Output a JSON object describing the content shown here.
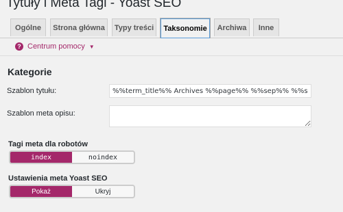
{
  "page": {
    "title": "Tytuły i Meta Tagi - Yoast SEO"
  },
  "tabs": [
    {
      "label": "Ogólne",
      "active": false
    },
    {
      "label": "Strona główna",
      "active": false
    },
    {
      "label": "Typy treści",
      "active": false
    },
    {
      "label": "Taksonomie",
      "active": true
    },
    {
      "label": "Archiwa",
      "active": false
    },
    {
      "label": "Inne",
      "active": false
    }
  ],
  "help": {
    "label": "Centrum pomocy",
    "icon": "question-circle-icon",
    "caret_icon": "caret-down-icon",
    "color": "#a4286a"
  },
  "section": {
    "title": "Kategorie"
  },
  "fields": {
    "title_template_label": "Szablon tytułu:",
    "title_template_value": "%%term_title%% Archives %%page%% %%sep%% %%sitename%%",
    "meta_template_label": "Szablon meta opisu:",
    "meta_template_value": ""
  },
  "robots": {
    "label": "Tagi meta dla robotów",
    "options": [
      "index",
      "noindex"
    ],
    "selected": "index"
  },
  "yoast_meta": {
    "label": "Ustawienia meta Yoast SEO",
    "options": [
      "Pokaż",
      "Ukryj"
    ],
    "selected": "Pokaż"
  },
  "colors": {
    "accent": "#a4286a",
    "tab_focus": "#5b9dd9"
  }
}
